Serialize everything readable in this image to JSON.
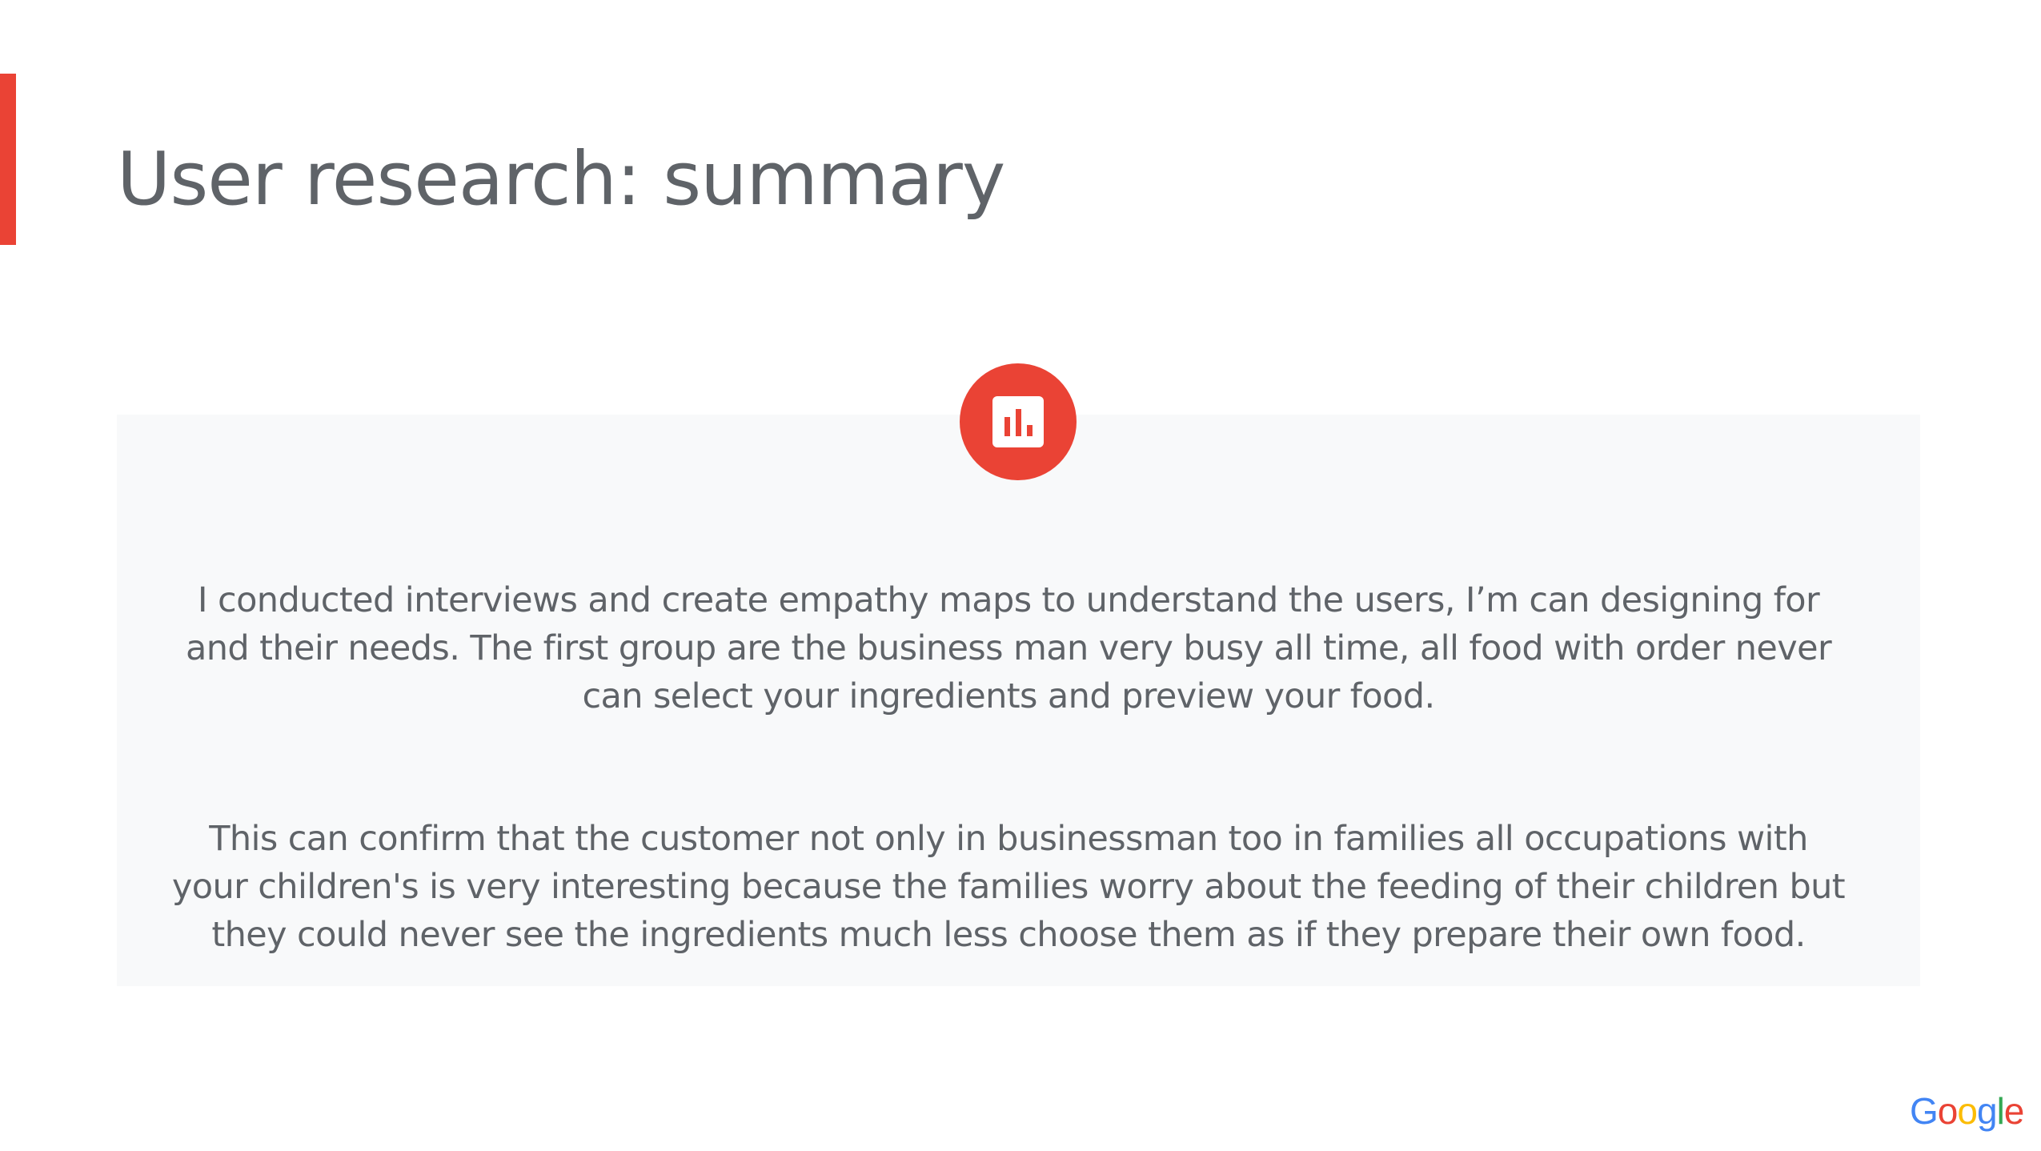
{
  "slide": {
    "title": "User research: summary",
    "paragraphs": [
      "I conducted interviews and create empathy maps to understand the users, I’m can designing for\nand their needs. The first group are the business man  very busy  all time, all food with order never\ncan select your ingredients  and preview your food.",
      "This can confirm that the customer not only in businessman too in families all occupations with\nyour children's is very interesting because the families worry about the feeding of their children but\nthey could never see the ingredients much less choose them as if they prepare their own food."
    ],
    "icon": "bar-chart-icon",
    "logo_text": "Google"
  },
  "colors": {
    "accent": "#ea4335",
    "title_text": "#5f6368",
    "panel_background": "#f8f9fa",
    "logo_blue": "#4285f4",
    "logo_red": "#ea4335",
    "logo_yellow": "#fbbc05",
    "logo_green": "#34a853"
  }
}
